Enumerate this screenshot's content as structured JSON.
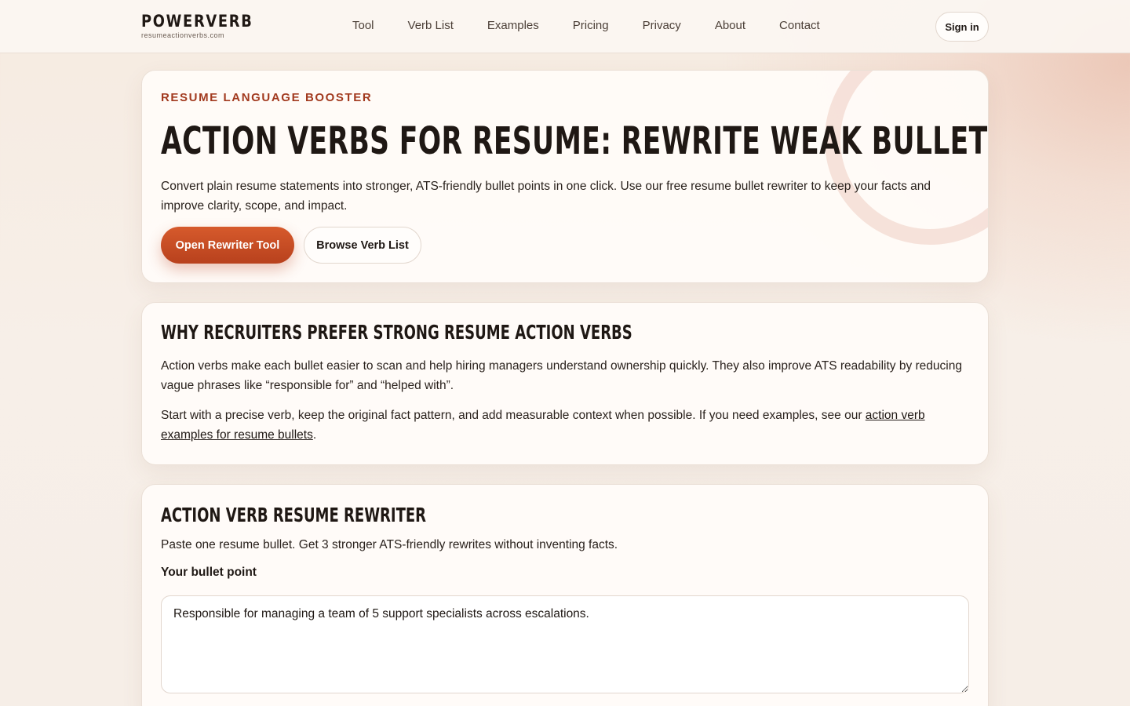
{
  "header": {
    "brand_name": "POWERVERB",
    "brand_domain": "resumeactionverbs.com",
    "nav": [
      "Tool",
      "Verb List",
      "Examples",
      "Pricing",
      "Privacy",
      "About",
      "Contact"
    ],
    "signin_label": "Sign in"
  },
  "hero": {
    "eyebrow": "RESUME LANGUAGE BOOSTER",
    "title": "ACTION VERBS FOR RESUME: REWRITE WEAK BULLETS FAST",
    "description": "Convert plain resume statements into stronger, ATS-friendly bullet points in one click. Use our free resume bullet rewriter to keep your facts and improve clarity, scope, and impact.",
    "primary_button": "Open Rewriter Tool",
    "secondary_button": "Browse Verb List"
  },
  "why": {
    "title": "WHY RECRUITERS PREFER STRONG RESUME ACTION VERBS",
    "paragraph1": "Action verbs make each bullet easier to scan and help hiring managers understand ownership quickly. They also improve ATS readability by reducing vague phrases like “responsible for” and “helped with”.",
    "paragraph2_prefix": "Start with a precise verb, keep the original fact pattern, and add measurable context when possible. If you need examples, see our ",
    "paragraph2_link": "action verb examples for resume bullets",
    "paragraph2_suffix": "."
  },
  "rewriter": {
    "title": "ACTION VERB RESUME REWRITER",
    "description": "Paste one resume bullet. Get 3 stronger ATS-friendly rewrites without inventing facts.",
    "field_label": "Your bullet point",
    "field_value": "Responsible for managing a team of 5 support specialists across escalations."
  },
  "colors": {
    "accent": "#c44b22",
    "eyebrow": "#a23a1f",
    "text": "#1f1814"
  }
}
